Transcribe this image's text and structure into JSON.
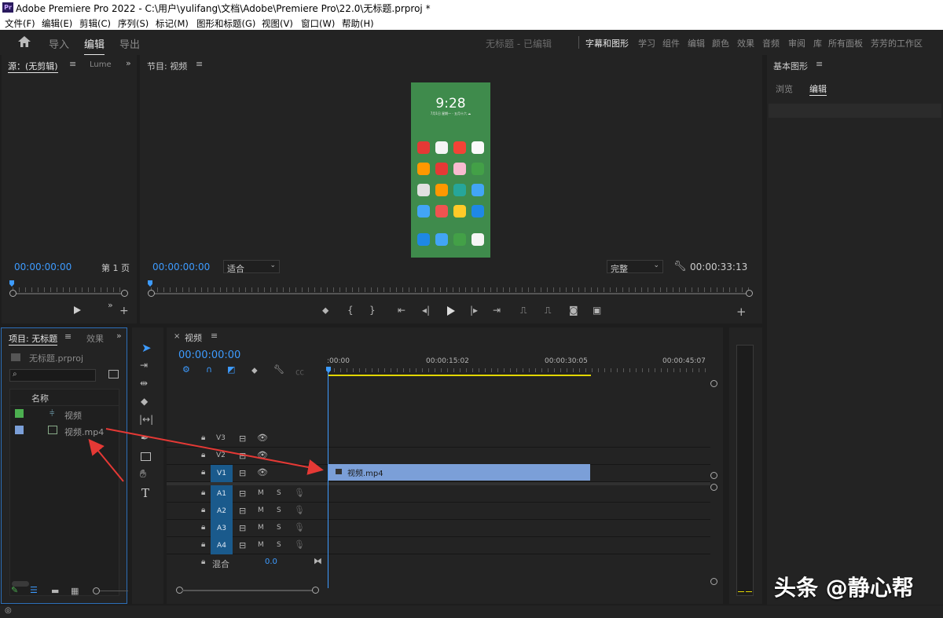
{
  "window": {
    "title": "Adobe Premiere Pro 2022 - C:\\用户\\yulifang\\文档\\Adobe\\Premiere Pro\\22.0\\无标题.prproj *",
    "app_badge": "Pr"
  },
  "menu": [
    "文件(F)",
    "编辑(E)",
    "剪辑(C)",
    "序列(S)",
    "标记(M)",
    "图形和标题(G)",
    "视图(V)",
    "窗口(W)",
    "帮助(H)"
  ],
  "topbar": {
    "tabs": [
      "导入",
      "编辑",
      "导出"
    ],
    "project_status": "无标题 - 已编辑",
    "workspaces": [
      "字幕和图形",
      "学习",
      "组件",
      "编辑",
      "颜色",
      "效果",
      "音频",
      "审阅",
      "库",
      "所有面板",
      "芳芳的工作区"
    ]
  },
  "source": {
    "tab": "源：(无剪辑)",
    "tab2": "Lume",
    "timecode": "00:00:00:00",
    "page": "第 1 页"
  },
  "program": {
    "tab": "节目: 视频",
    "timecode": "00:00:00:00",
    "fit": "适合",
    "quality": "完整",
    "duration": "00:00:33:13"
  },
  "phone": {
    "time": "9:28",
    "date": "7月1日 星期一 · 五月十六 ☁"
  },
  "essential_graphics": {
    "title": "基本图形",
    "tabs": [
      "浏览",
      "编辑"
    ]
  },
  "project": {
    "tab": "项目: 无标题",
    "tab2": "效果",
    "file": "无标题.prproj",
    "search_placeholder": "",
    "column": "名称",
    "items": [
      {
        "name": "视频",
        "color": "#4caf50"
      },
      {
        "name": "视频.mp4",
        "color": "#7b9fd8"
      }
    ]
  },
  "timeline": {
    "tab": "视频",
    "timecode": "00:00:00:00",
    "ruler": [
      ":00:00",
      "00:00:15:02",
      "00:00:30:05",
      "00:00:45:07"
    ],
    "video_tracks": [
      "V3",
      "V2",
      "V1"
    ],
    "audio_tracks": [
      "A1",
      "A2",
      "A3",
      "A4"
    ],
    "mix_label": "混合",
    "mix_value": "0.0",
    "clip": "视频.mp4",
    "audio_labels": {
      "mute": "M",
      "solo": "S"
    }
  },
  "watermark": "头条 @静心帮",
  "colors": {
    "accent": "#3d9bff",
    "arrow": "#e53935",
    "clip": "#7b9fd8",
    "workarea": "#e3d700"
  }
}
